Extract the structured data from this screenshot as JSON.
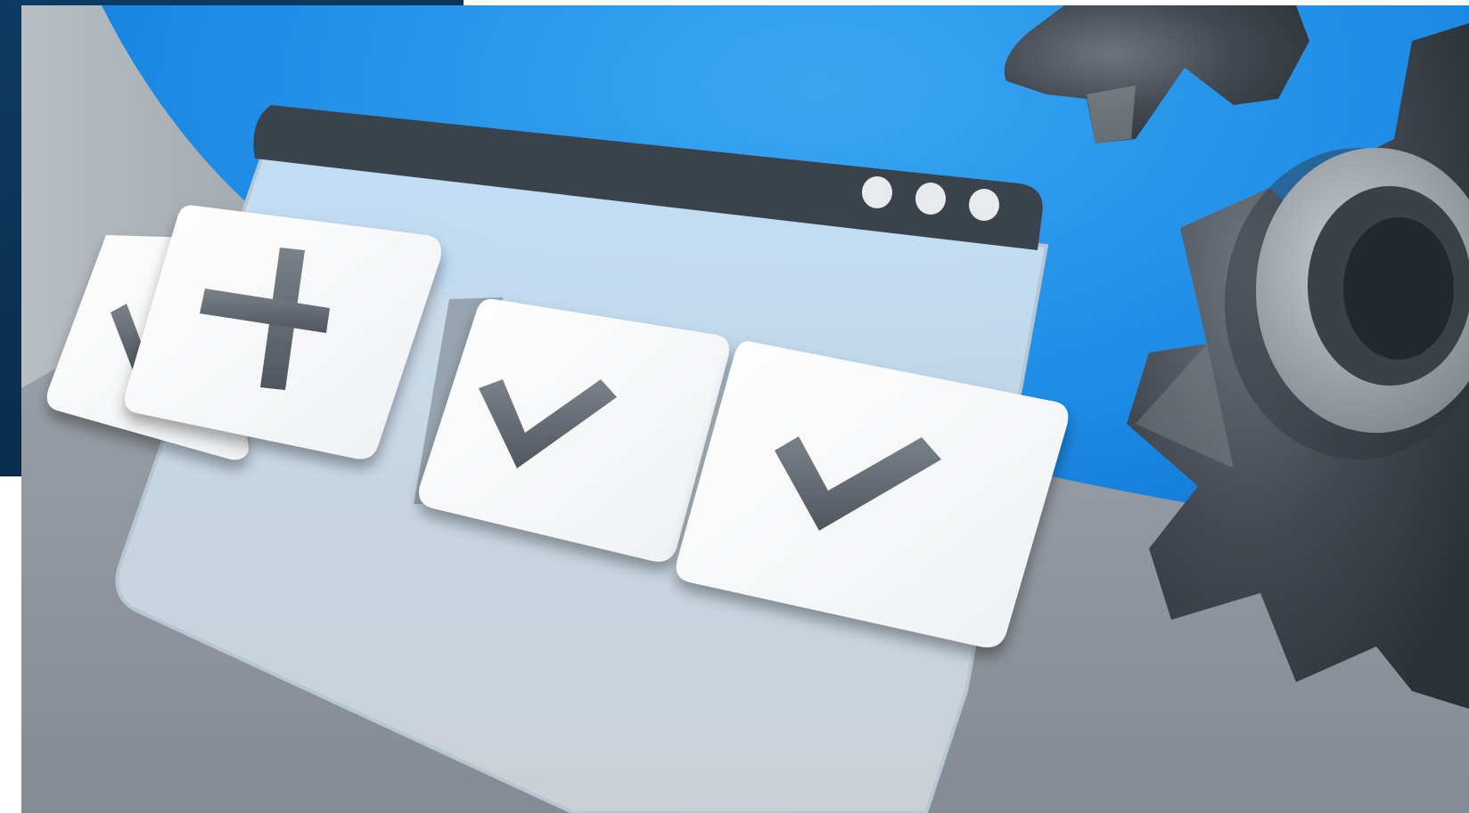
{
  "scene": {
    "colors": {
      "corner_panel": "#0c3b63",
      "sky_blue": "#1e8ee8",
      "floor_gray": "#8a9097",
      "window_bar": "#3a424b",
      "card_white": "#ffffff",
      "glyph_gray": "#5e656d",
      "gear_dark": "#3d444c"
    },
    "icons": [
      "window-illustration",
      "window-dots-icon",
      "plus-icon",
      "checkmark-icon",
      "gear-icon"
    ]
  }
}
